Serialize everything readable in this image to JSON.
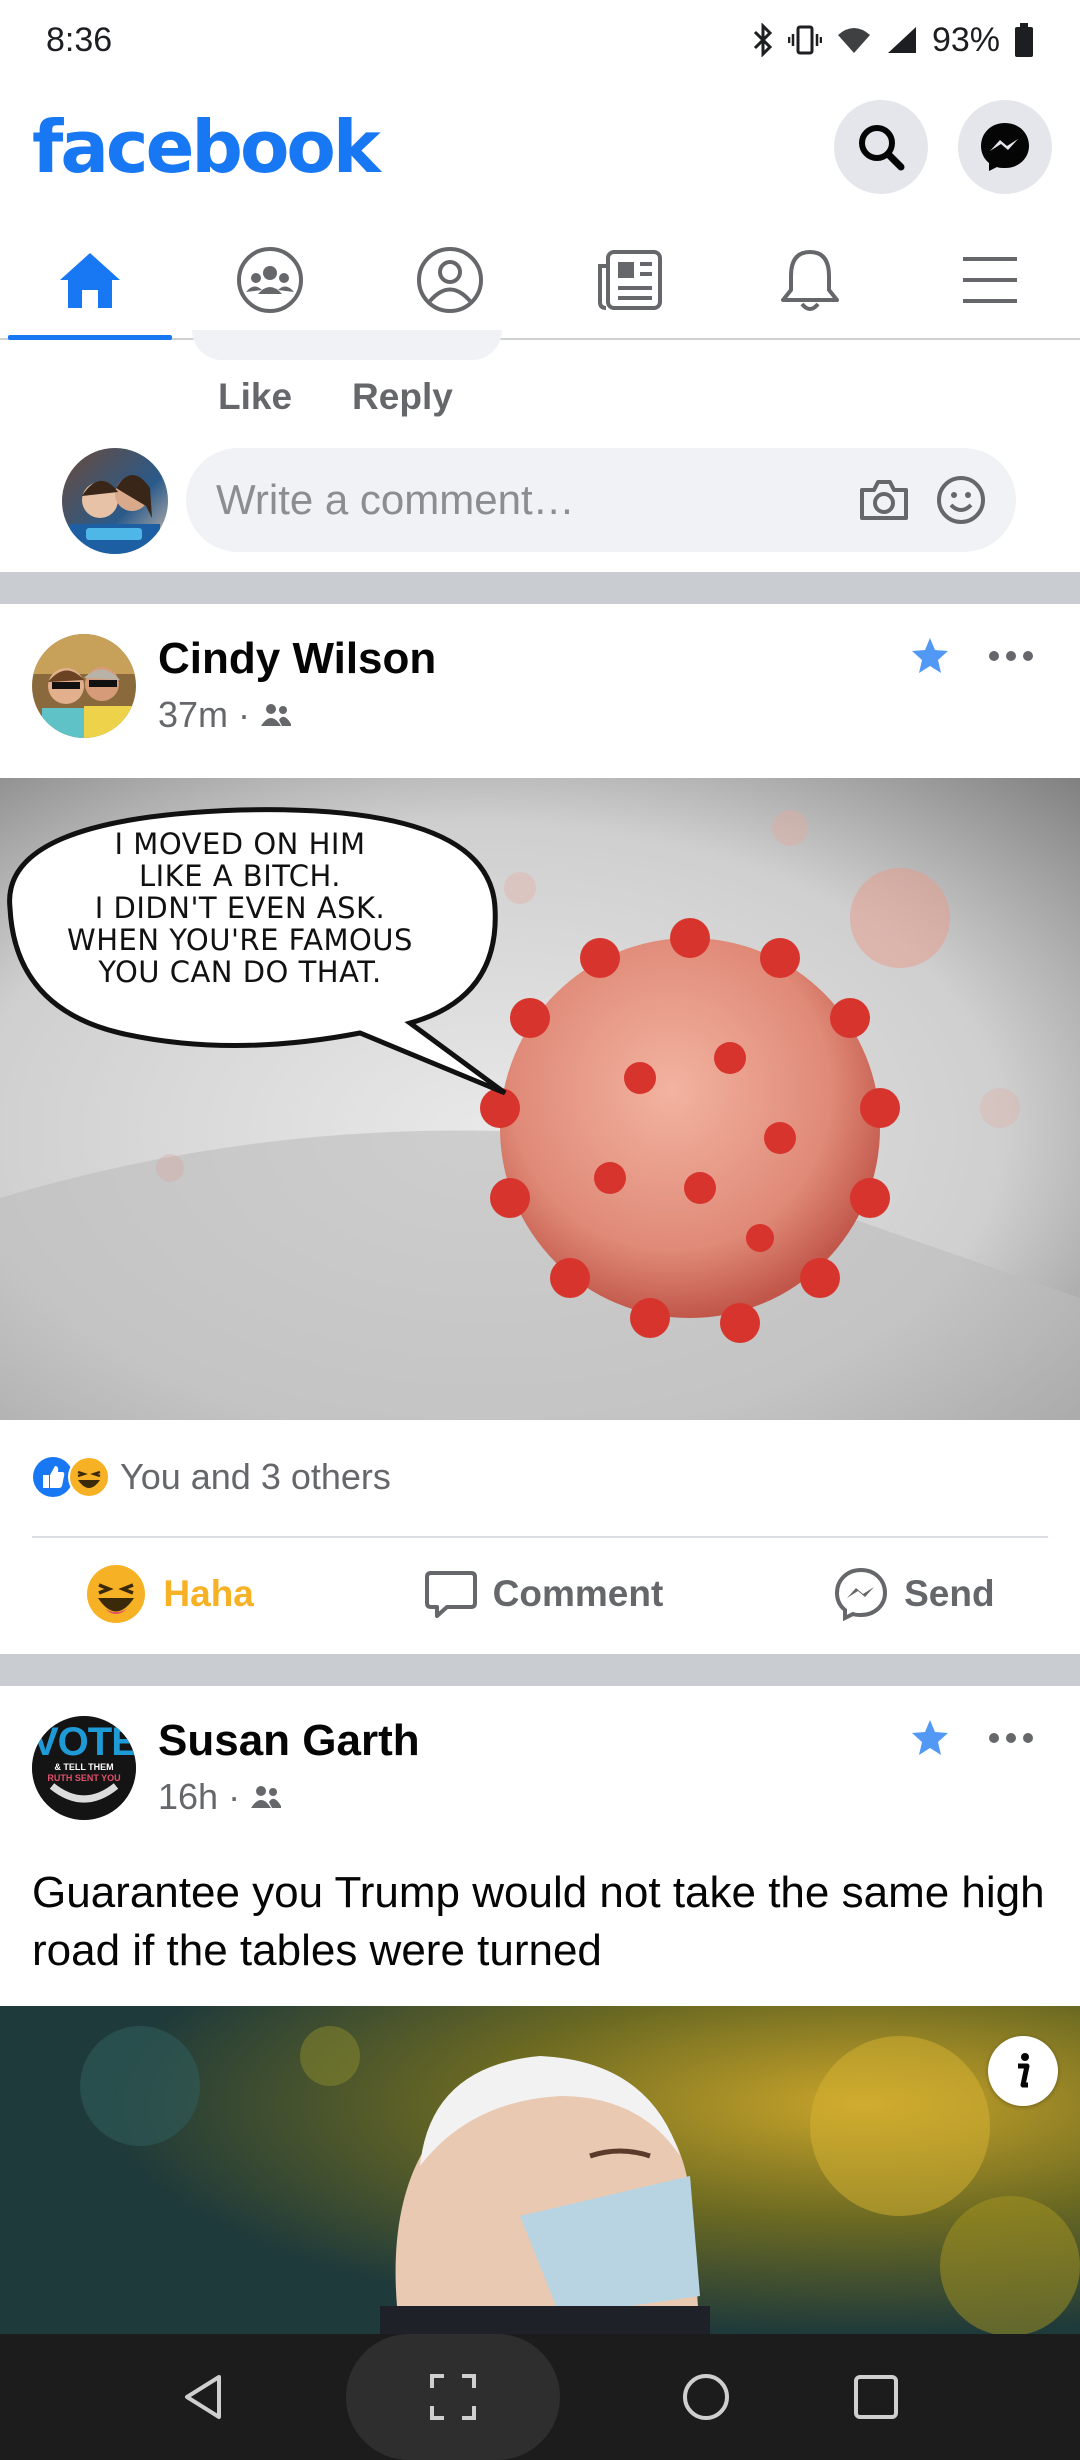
{
  "status_bar": {
    "time": "8:36",
    "battery": "93%"
  },
  "header": {
    "logo": "facebook",
    "icons": [
      "search-icon",
      "messenger-icon"
    ]
  },
  "tabs": [
    "home-icon",
    "groups-icon",
    "profile-icon",
    "news-icon",
    "notifications-icon",
    "menu-icon"
  ],
  "comment_section": {
    "like_label": "Like",
    "reply_label": "Reply",
    "input_placeholder": "Write a comment…"
  },
  "posts": [
    {
      "author": "Cindy Wilson",
      "time": "37m",
      "meme_text": [
        "I MOVED ON HIM",
        "LIKE A BITCH.",
        "I DIDN'T EVEN ASK.",
        "WHEN YOU'RE FAMOUS",
        "YOU CAN DO THAT."
      ],
      "reactions_text": "You and 3 others",
      "actions": {
        "haha": "Haha",
        "comment": "Comment",
        "send": "Send"
      }
    },
    {
      "author": "Susan Garth",
      "time": "16h",
      "avatar_text": {
        "main": "VOTE",
        "line1": "& TELL THEM",
        "line2": "RUTH SENT YOU"
      },
      "text": "Guarantee you Trump would not take the same high road if the tables were turned"
    }
  ],
  "colors": {
    "brand": "#1877f2",
    "haha": "#f7b125",
    "nav_bar": "#1c1c1c"
  }
}
